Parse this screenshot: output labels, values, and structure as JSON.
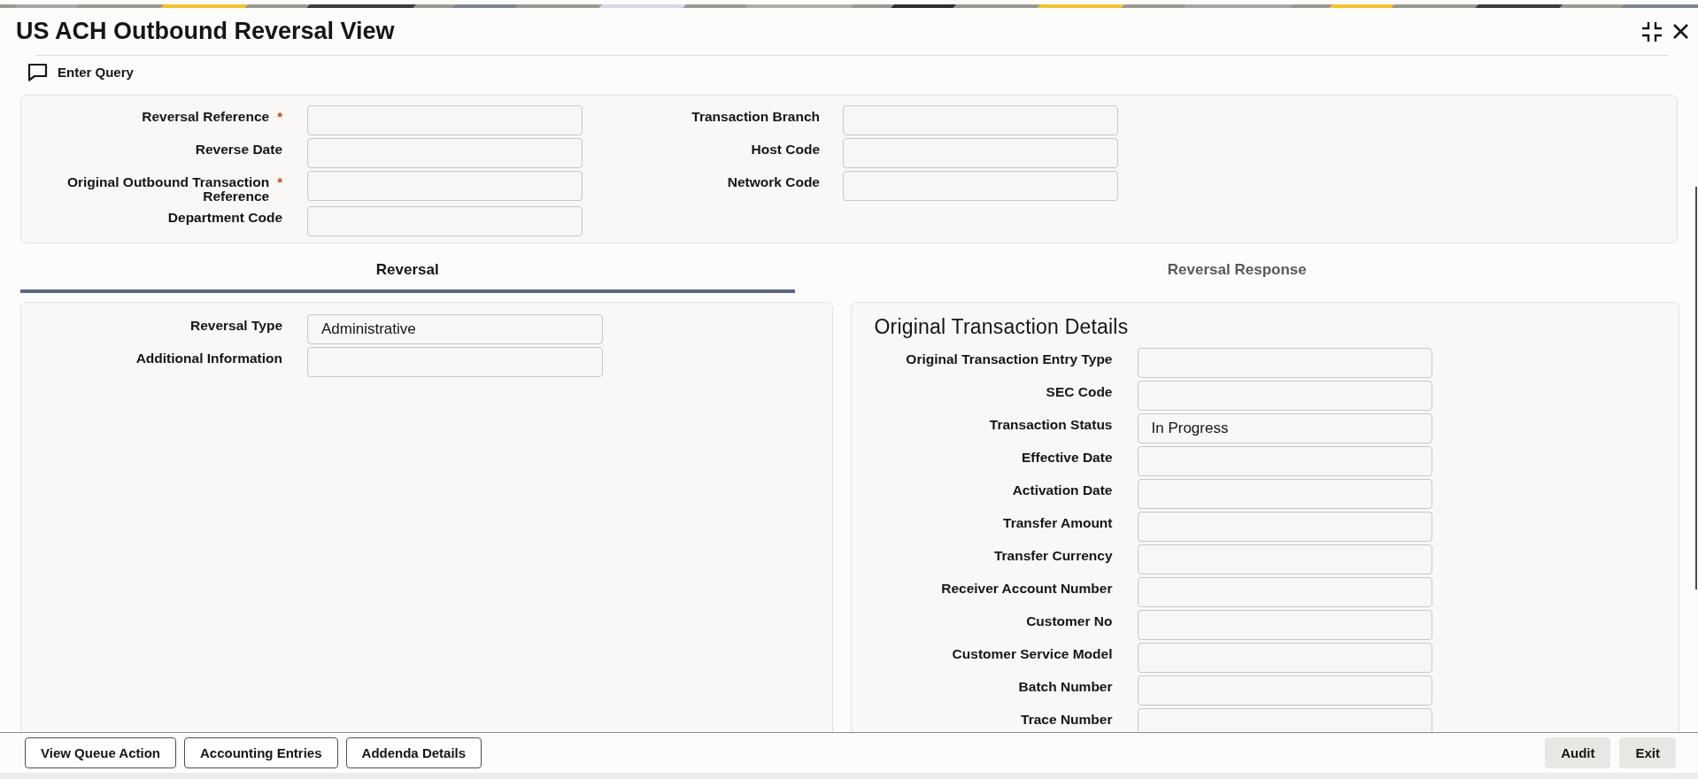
{
  "window": {
    "title": "US ACH Outbound Reversal View"
  },
  "window_controls": [
    {
      "kind": "collapse"
    },
    {
      "kind": "close"
    }
  ],
  "toolbar": [
    {
      "label": "Enter Query",
      "kind": "query"
    }
  ],
  "header_fields": {
    "columns": [
      [
        {
          "label": "Reversal Reference",
          "required_mark": "*"
        },
        {
          "label": "Reverse Date"
        },
        {
          "label": "Original Outbound Transaction Reference",
          "required_mark": "*"
        },
        {
          "label": "Department Code"
        }
      ],
      [
        {
          "label": "Transaction Branch"
        },
        {
          "label": "Host Code"
        },
        {
          "label": "Network Code"
        }
      ]
    ]
  },
  "tabs": [
    {
      "label": "Reversal",
      "selected": true
    },
    {
      "label": "Reversal Response",
      "selected": false
    }
  ],
  "reversal_panel": {
    "fields": [
      {
        "label": "Reversal Type",
        "value": "Administrative"
      },
      {
        "label": "Additional Information"
      }
    ]
  },
  "details_panel": {
    "title": "Original Transaction Details",
    "fields": [
      {
        "label": "Original Transaction Entry Type"
      },
      {
        "label": "SEC Code"
      },
      {
        "label": "Transaction Status",
        "value": "In Progress"
      },
      {
        "label": "Effective Date"
      },
      {
        "label": "Activation Date"
      },
      {
        "label": "Transfer Amount"
      },
      {
        "label": "Transfer Currency"
      },
      {
        "label": "Receiver Account Number"
      },
      {
        "label": "Customer No"
      },
      {
        "label": "Customer Service Model"
      },
      {
        "label": "Batch Number"
      },
      {
        "label": "Trace Number"
      }
    ]
  },
  "footer": {
    "left_buttons": [
      "View Queue Action",
      "Accounting Entries",
      "Addenda Details"
    ],
    "right_buttons": [
      "Audit",
      "Exit"
    ]
  }
}
